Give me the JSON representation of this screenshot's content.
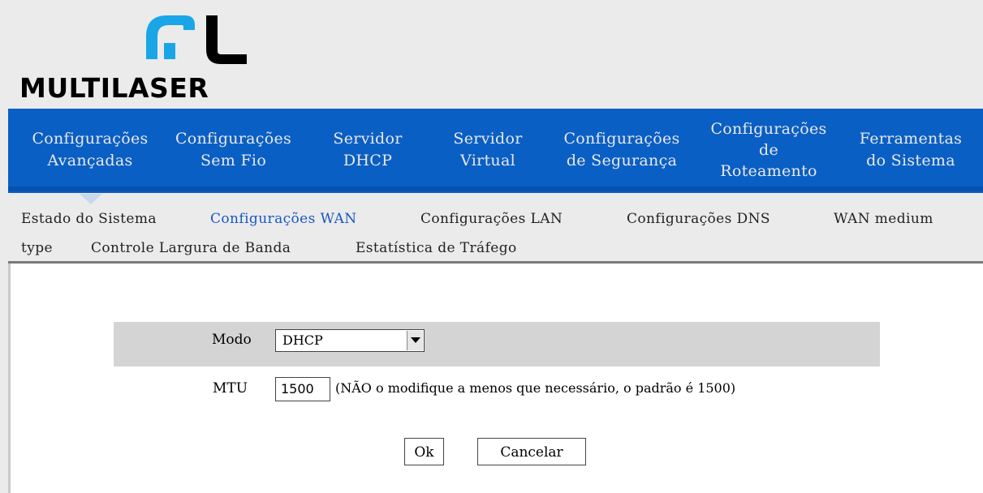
{
  "brand": {
    "name": "MULTILASER",
    "primary_color": "#0a5fc4"
  },
  "topnav": [
    {
      "line1": "Configurações",
      "line2": "Avançadas",
      "line3": ""
    },
    {
      "line1": "Configurações",
      "line2": "Sem Fio",
      "line3": ""
    },
    {
      "line1": "Servidor",
      "line2": "DHCP",
      "line3": ""
    },
    {
      "line1": "Servidor",
      "line2": "Virtual",
      "line3": ""
    },
    {
      "line1": "Configurações",
      "line2": "de Segurança",
      "line3": ""
    },
    {
      "line1": "Configurações",
      "line2": "de",
      "line3": "Roteamento"
    },
    {
      "line1": "Ferramentas",
      "line2": "do Sistema",
      "line3": ""
    }
  ],
  "subnav": [
    {
      "label": "Estado do Sistema",
      "active": false
    },
    {
      "label": "Configurações WAN",
      "active": true
    },
    {
      "label": "Configurações LAN",
      "active": false
    },
    {
      "label": "Configurações DNS",
      "active": false
    },
    {
      "label": "WAN medium",
      "active": false
    },
    {
      "label": "type",
      "active": false
    },
    {
      "label": "Controle Largura de Banda",
      "active": false
    },
    {
      "label": "Estatística de Tráfego",
      "active": false
    }
  ],
  "form": {
    "mode_label": "Modo",
    "mode_value": "DHCP",
    "mtu_label": "MTU",
    "mtu_value": "1500",
    "mtu_note": "(NÃO o modifique a menos que necessário, o padrão é 1500)",
    "ok_label": "Ok",
    "cancel_label": "Cancelar"
  },
  "icons": {
    "logo": "multilaser-logo-icon",
    "dropdown": "dropdown-arrow-icon"
  }
}
